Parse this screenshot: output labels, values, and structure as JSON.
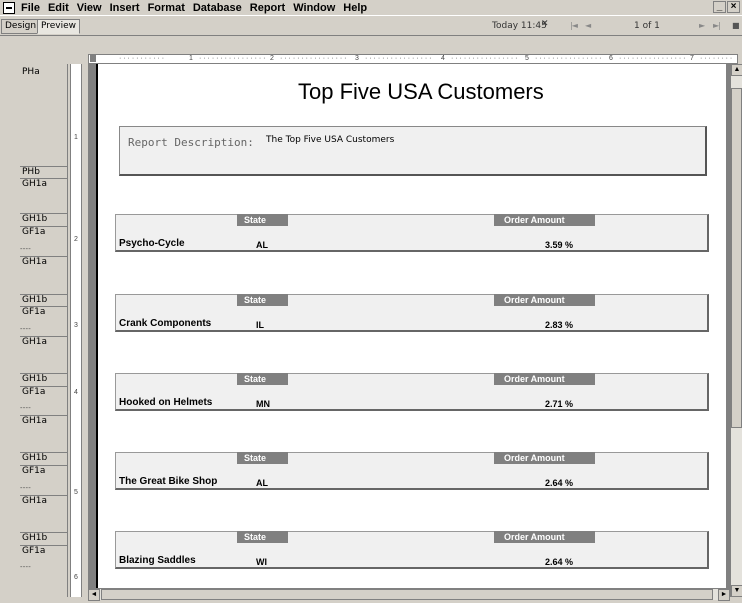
{
  "menu": {
    "items": [
      "File",
      "Edit",
      "View",
      "Insert",
      "Format",
      "Database",
      "Report",
      "Window",
      "Help"
    ],
    "window_controls": [
      "_",
      "×"
    ]
  },
  "tabs": {
    "design": "Design",
    "preview": "Preview"
  },
  "navigation": {
    "timestamp": "Today 11:45",
    "close_symbol": "✕",
    "page_indicator": "1 of 1",
    "first": "|◄",
    "prev": "◄",
    "next": "►",
    "last": "►|",
    "stop": "■"
  },
  "ruler": {
    "h_labels": [
      "1",
      "2",
      "3",
      "4",
      "5",
      "6",
      "7"
    ],
    "v_labels": [
      "1",
      "2",
      "3",
      "4",
      "5",
      "6"
    ]
  },
  "sections": {
    "pha": "PHa",
    "phb": "PHb",
    "gh1a": "GH1a",
    "gh1b": "GH1b",
    "gf1a": "GF1a",
    "dashes": "- - - -"
  },
  "report": {
    "title": "Top Five USA Customers",
    "description_label": "Report Description:",
    "description_value": "The Top Five USA Customers",
    "state_header": "State",
    "amount_header": "Order Amount",
    "rows": [
      {
        "customer": "Psycho-Cycle",
        "state": "AL",
        "amount": "3.59 %"
      },
      {
        "customer": "Crank Components",
        "state": "IL",
        "amount": "2.83 %"
      },
      {
        "customer": "Hooked on Helmets",
        "state": "MN",
        "amount": "2.71 %"
      },
      {
        "customer": "The Great Bike Shop",
        "state": "AL",
        "amount": "2.64 %"
      },
      {
        "customer": "Blazing Saddles",
        "state": "WI",
        "amount": "2.64 %"
      }
    ]
  },
  "colors": {
    "header_bg": "#808080",
    "canvas_bg": "#ffffff",
    "chrome": "#d4d0c8"
  }
}
